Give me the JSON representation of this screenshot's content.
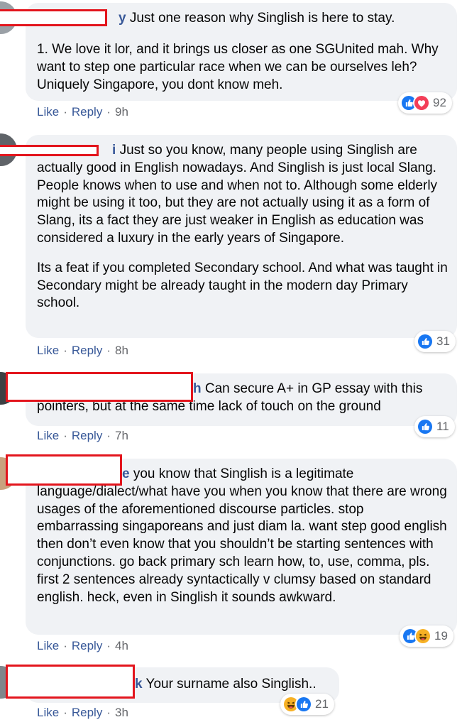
{
  "action_labels": {
    "like": "Like",
    "reply": "Reply",
    "separator": "·"
  },
  "comments": [
    {
      "name_tail": "y",
      "paragraphs": [
        "Just one reason why Singlish is here to stay.",
        "1. We love it lor, and it brings us closer as one SGUnited mah. Why want to step one particular race when we can be ourselves leh? Uniquely Singapore, you dont know meh."
      ],
      "time": "9h",
      "reactions": {
        "icons": [
          "like-icon",
          "love-icon"
        ],
        "count": "92"
      }
    },
    {
      "name_tail": "i",
      "paragraphs": [
        "Just so you know, many people using Singlish are actually good in English nowadays. And Singlish is just local Slang. People knows when to use and when not to. Although some elderly might be using it too, but they are not actually using it as a form of Slang, its a fact they are just weaker in English as education was considered a luxury in the early years of Singapore.",
        "Its a feat if you completed Secondary school. And what was taught in Secondary might be already taught in the modern day Primary school."
      ],
      "time": "8h",
      "reactions": {
        "icons": [
          "like-icon"
        ],
        "count": "31"
      }
    },
    {
      "name_tail": "h",
      "paragraphs": [
        "Can secure A+ in GP essay with this pointers, but at the same time lack of touch on the ground"
      ],
      "time": "7h",
      "reactions": {
        "icons": [
          "like-icon"
        ],
        "count": "11"
      }
    },
    {
      "name_tail": "e",
      "paragraphs": [
        "you know that Singlish is a legitimate language/dialect/what have you when you know that there are wrong usages of the aforementioned discourse particles. stop embarrassing singaporeans and just diam la. want step good english then don’t even know that you shouldn’t be starting sentences with conjunctions. go back primary sch learn how, to, use, comma, pls. first 2 sentences already syntactically v clumsy based on standard english. heck, even in Singlish it sounds awkward."
      ],
      "time": "4h",
      "reactions": {
        "icons": [
          "like-icon",
          "haha-icon"
        ],
        "count": "19"
      }
    },
    {
      "name_tail": "k",
      "paragraphs": [
        "Your surname also Singlish.."
      ],
      "time": "3h",
      "reactions": {
        "icons": [
          "haha-icon",
          "like-icon"
        ],
        "count": "21"
      }
    }
  ],
  "colors": {
    "link": "#385898",
    "meta": "#65676b",
    "bubble": "#f0f2f5",
    "redaction": "#e3151d",
    "like": "#1877f2",
    "love": "#f33e58",
    "haha": "#f7b125"
  }
}
